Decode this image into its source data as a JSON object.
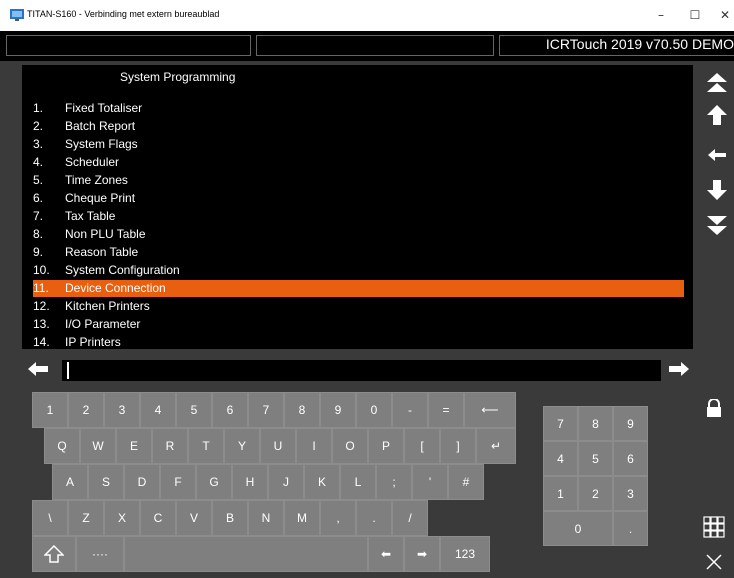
{
  "window": {
    "title": "TITAN-S160 - Verbinding met extern bureaublad",
    "min_glyph": "–",
    "max_glyph": "☐",
    "close_glyph": "✕"
  },
  "status": {
    "version": "ICRTouch 2019 v70.50 DEMO"
  },
  "menu": {
    "title": "System Programming",
    "items": [
      {
        "num": "1.",
        "label": "Fixed Totaliser"
      },
      {
        "num": "2.",
        "label": "Batch Report"
      },
      {
        "num": "3.",
        "label": "System Flags"
      },
      {
        "num": "4.",
        "label": "Scheduler"
      },
      {
        "num": "5.",
        "label": "Time Zones"
      },
      {
        "num": "6.",
        "label": "Cheque Print"
      },
      {
        "num": "7.",
        "label": "Tax Table"
      },
      {
        "num": "8.",
        "label": "Non PLU Table"
      },
      {
        "num": "9.",
        "label": "Reason Table"
      },
      {
        "num": "10.",
        "label": "System Configuration"
      },
      {
        "num": "11.",
        "label": "Device Connection"
      },
      {
        "num": "12.",
        "label": "Kitchen Printers"
      },
      {
        "num": "13.",
        "label": "I/O Parameter"
      },
      {
        "num": "14.",
        "label": "IP Printers"
      }
    ],
    "selected_index": 10,
    "highlight_color": "#e8600f"
  },
  "input": {
    "value": ""
  },
  "keyboard": {
    "row1": [
      "1",
      "2",
      "3",
      "4",
      "5",
      "6",
      "7",
      "8",
      "9",
      "0",
      "-",
      "="
    ],
    "row2": [
      "Q",
      "W",
      "E",
      "R",
      "T",
      "Y",
      "U",
      "I",
      "O",
      "P",
      "[",
      "]"
    ],
    "row3": [
      "A",
      "S",
      "D",
      "F",
      "G",
      "H",
      "J",
      "K",
      "L",
      ";",
      "'",
      "#"
    ],
    "row4": [
      "\\",
      "Z",
      "X",
      "C",
      "V",
      "B",
      "N",
      "M",
      ",",
      ".",
      "/"
    ],
    "backspace_glyph": "⟵",
    "enter_glyph": "↵",
    "more_label": "····",
    "left_glyph": "⬅",
    "right_glyph": "➡",
    "mode_label": "123"
  },
  "numpad": {
    "rows": [
      [
        "7",
        "8",
        "9"
      ],
      [
        "4",
        "5",
        "6"
      ],
      [
        "1",
        "2",
        "3"
      ]
    ],
    "zero": "0",
    "dot": "."
  },
  "icons": {
    "scroll_top": "double-chevron-up-icon",
    "scroll_up": "arrow-up-icon",
    "scroll_back": "arrow-left-icon",
    "scroll_down": "arrow-down-icon",
    "scroll_bottom": "double-chevron-down-icon",
    "lock": "lock-icon",
    "grid": "grid-icon",
    "close": "close-icon",
    "shift": "shift-icon"
  }
}
